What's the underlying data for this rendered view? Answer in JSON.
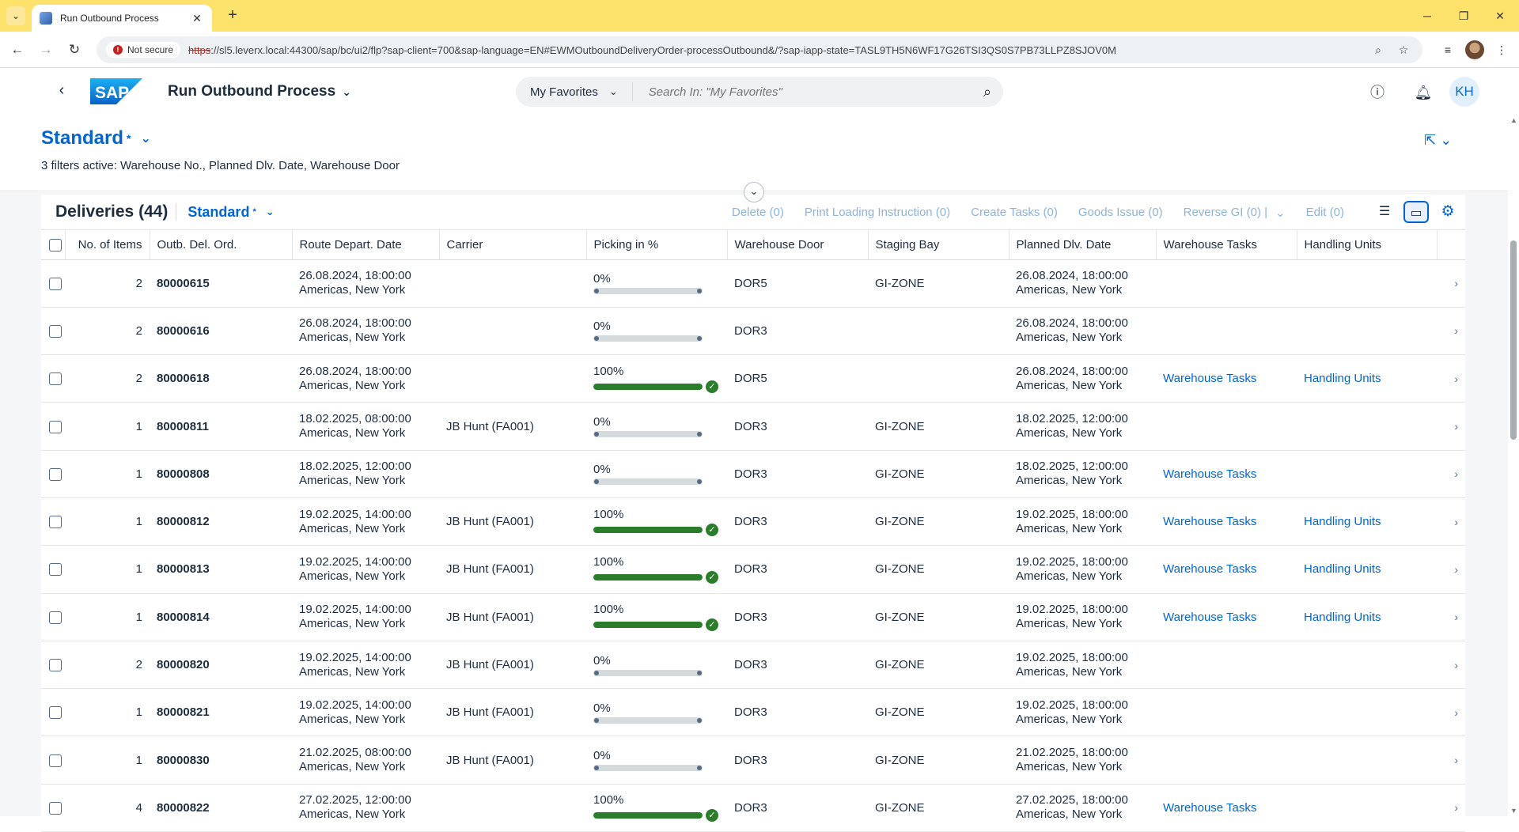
{
  "browser": {
    "tab_title": "Run Outbound Process",
    "tab_close": "✕",
    "new_tab": "+",
    "not_secure_label": "Not secure",
    "url_protocol": "https",
    "url_rest": "://sl5.leverx.local:44300/sap/bc/ui2/flp?sap-client=700&sap-language=EN#EWMOutboundDeliveryOrder-processOutbound&/?sap-iapp-state=TASL9TH5N6WF17G26TSI3QS0S7PB73LLPZ8SJOV0M"
  },
  "shell": {
    "app_title": "Run Outbound Process",
    "search_scope": "My Favorites",
    "search_placeholder": "Search In: \"My Favorites\"",
    "avatar_initials": "KH"
  },
  "header": {
    "variant_name": "Standard",
    "variant_modified": "*",
    "filters_text": "3 filters active: Warehouse No., Planned Dlv. Date, Warehouse Door"
  },
  "toolbar": {
    "title": "Deliveries (44)",
    "variant_name": "Standard",
    "variant_modified": "*",
    "actions": {
      "delete": "Delete (0)",
      "print": "Print Loading Instruction (0)",
      "create_tasks": "Create Tasks (0)",
      "goods_issue": "Goods Issue (0)",
      "reverse_gi": "Reverse GI (0) |",
      "edit": "Edit (0)"
    }
  },
  "table": {
    "columns": {
      "items": "No. of Items",
      "order": "Outb. Del. Ord.",
      "route": "Route Depart. Date",
      "carrier": "Carrier",
      "picking": "Picking in %",
      "door": "Warehouse Door",
      "bay": "Staging Bay",
      "planned": "Planned Dlv. Date",
      "wt": "Warehouse Tasks",
      "hu": "Handling Units"
    },
    "rows": [
      {
        "items": "2",
        "order": "80000615",
        "route_date": "26.08.2024, 18:00:00",
        "route_tz": "Americas, New York",
        "carrier": "",
        "pct_text": "0%",
        "pct": 0,
        "door": "DOR5",
        "bay": "GI-ZONE",
        "planned_date": "26.08.2024, 18:00:00",
        "planned_tz": "Americas, New York",
        "wt": "",
        "hu": ""
      },
      {
        "items": "2",
        "order": "80000616",
        "route_date": "26.08.2024, 18:00:00",
        "route_tz": "Americas, New York",
        "carrier": "",
        "pct_text": "0%",
        "pct": 0,
        "door": "DOR3",
        "bay": "",
        "planned_date": "26.08.2024, 18:00:00",
        "planned_tz": "Americas, New York",
        "wt": "",
        "hu": ""
      },
      {
        "items": "2",
        "order": "80000618",
        "route_date": "26.08.2024, 18:00:00",
        "route_tz": "Americas, New York",
        "carrier": "",
        "pct_text": "100%",
        "pct": 100,
        "door": "DOR5",
        "bay": "",
        "planned_date": "26.08.2024, 18:00:00",
        "planned_tz": "Americas, New York",
        "wt": "Warehouse Tasks",
        "hu": "Handling Units"
      },
      {
        "items": "1",
        "order": "80000811",
        "route_date": "18.02.2025, 08:00:00",
        "route_tz": "Americas, New York",
        "carrier": "JB Hunt (FA001)",
        "pct_text": "0%",
        "pct": 0,
        "door": "DOR3",
        "bay": "GI-ZONE",
        "planned_date": "18.02.2025, 12:00:00",
        "planned_tz": "Americas, New York",
        "wt": "",
        "hu": ""
      },
      {
        "items": "1",
        "order": "80000808",
        "route_date": "18.02.2025, 12:00:00",
        "route_tz": "Americas, New York",
        "carrier": "",
        "pct_text": "0%",
        "pct": 0,
        "door": "DOR3",
        "bay": "GI-ZONE",
        "planned_date": "18.02.2025, 12:00:00",
        "planned_tz": "Americas, New York",
        "wt": "Warehouse Tasks",
        "hu": ""
      },
      {
        "items": "1",
        "order": "80000812",
        "route_date": "19.02.2025, 14:00:00",
        "route_tz": "Americas, New York",
        "carrier": "JB Hunt (FA001)",
        "pct_text": "100%",
        "pct": 100,
        "door": "DOR3",
        "bay": "GI-ZONE",
        "planned_date": "19.02.2025, 18:00:00",
        "planned_tz": "Americas, New York",
        "wt": "Warehouse Tasks",
        "hu": "Handling Units"
      },
      {
        "items": "1",
        "order": "80000813",
        "route_date": "19.02.2025, 14:00:00",
        "route_tz": "Americas, New York",
        "carrier": "JB Hunt (FA001)",
        "pct_text": "100%",
        "pct": 100,
        "door": "DOR3",
        "bay": "GI-ZONE",
        "planned_date": "19.02.2025, 18:00:00",
        "planned_tz": "Americas, New York",
        "wt": "Warehouse Tasks",
        "hu": "Handling Units"
      },
      {
        "items": "1",
        "order": "80000814",
        "route_date": "19.02.2025, 14:00:00",
        "route_tz": "Americas, New York",
        "carrier": "JB Hunt (FA001)",
        "pct_text": "100%",
        "pct": 100,
        "door": "DOR3",
        "bay": "GI-ZONE",
        "planned_date": "19.02.2025, 18:00:00",
        "planned_tz": "Americas, New York",
        "wt": "Warehouse Tasks",
        "hu": "Handling Units"
      },
      {
        "items": "2",
        "order": "80000820",
        "route_date": "19.02.2025, 14:00:00",
        "route_tz": "Americas, New York",
        "carrier": "JB Hunt (FA001)",
        "pct_text": "0%",
        "pct": 0,
        "door": "DOR3",
        "bay": "GI-ZONE",
        "planned_date": "19.02.2025, 18:00:00",
        "planned_tz": "Americas, New York",
        "wt": "",
        "hu": ""
      },
      {
        "items": "1",
        "order": "80000821",
        "route_date": "19.02.2025, 14:00:00",
        "route_tz": "Americas, New York",
        "carrier": "JB Hunt (FA001)",
        "pct_text": "0%",
        "pct": 0,
        "door": "DOR3",
        "bay": "GI-ZONE",
        "planned_date": "19.02.2025, 18:00:00",
        "planned_tz": "Americas, New York",
        "wt": "",
        "hu": ""
      },
      {
        "items": "1",
        "order": "80000830",
        "route_date": "21.02.2025, 08:00:00",
        "route_tz": "Americas, New York",
        "carrier": "JB Hunt (FA001)",
        "pct_text": "0%",
        "pct": 0,
        "door": "DOR3",
        "bay": "GI-ZONE",
        "planned_date": "21.02.2025, 18:00:00",
        "planned_tz": "Americas, New York",
        "wt": "",
        "hu": ""
      },
      {
        "items": "4",
        "order": "80000822",
        "route_date": "27.02.2025, 12:00:00",
        "route_tz": "Americas, New York",
        "carrier": "",
        "pct_text": "100%",
        "pct": 100,
        "door": "DOR3",
        "bay": "GI-ZONE",
        "planned_date": "27.02.2025, 18:00:00",
        "planned_tz": "Americas, New York",
        "wt": "Warehouse Tasks",
        "hu": ""
      }
    ]
  },
  "colors": {
    "tabbar": "#fde26b",
    "sap_blue": "#0064d9",
    "success_green": "#2b7c2b",
    "disabled_action": "#8fb3d9"
  },
  "icons": {
    "tab_menu": "chevron-down-icon",
    "back": "arrow-left-icon",
    "forward": "arrow-right-icon",
    "reload": "reload-icon",
    "zoom": "zoom-icon",
    "bookmark": "star-icon",
    "help": "help-icon",
    "notifications": "bell-icon",
    "search": "search-icon",
    "settings": "gear-icon",
    "share": "share-icon",
    "row_nav": "chevron-right-icon",
    "complete": "check-circle-icon"
  }
}
